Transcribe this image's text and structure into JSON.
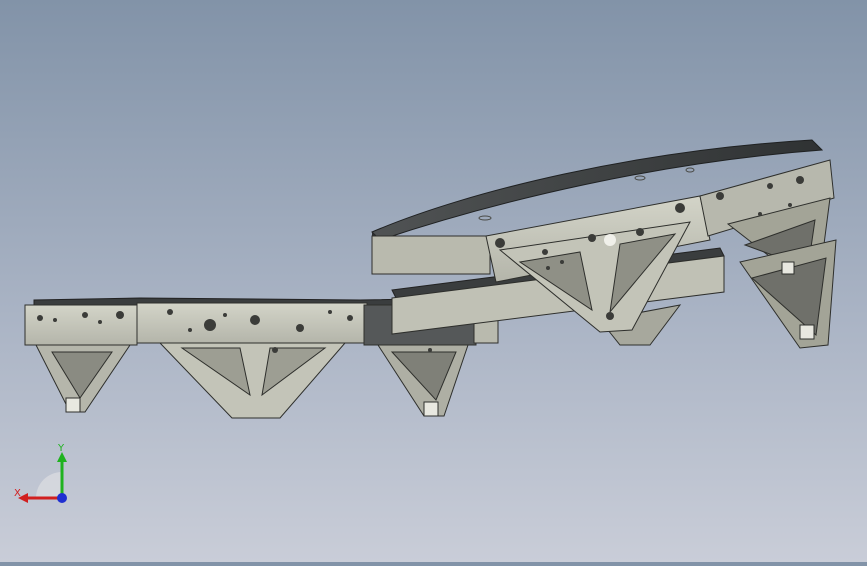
{
  "viewport": {
    "background_top": "#8293a8",
    "background_bottom": "#c9cdd8",
    "part_color": "#c8c9bd",
    "part_shadow": "#9d9e93",
    "part_edge": "#2e2f2c",
    "cover_color": "#3e4142",
    "cover_dark": "#2c2e2f"
  },
  "triad": {
    "x_label": "X",
    "y_label": "Y",
    "x_color": "#d11f1f",
    "y_color": "#1fb21f",
    "z_color": "#1f2fd1"
  }
}
